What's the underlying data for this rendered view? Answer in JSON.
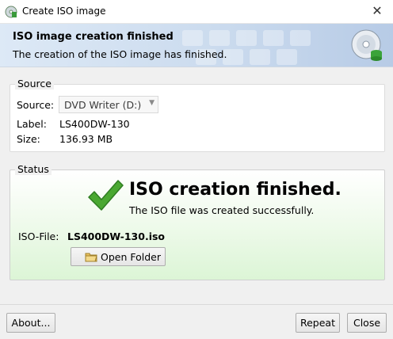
{
  "window": {
    "title": "Create ISO image",
    "close_glyph": "✕"
  },
  "banner": {
    "title": "ISO image creation finished",
    "subtitle": "The creation of the ISO image has finished."
  },
  "source": {
    "legend": "Source",
    "source_label": "Source:",
    "source_value": "DVD Writer (D:)",
    "label_label": "Label:",
    "label_value": "LS400DW-130",
    "size_label": "Size:",
    "size_value": "136.93 MB"
  },
  "status": {
    "legend": "Status",
    "headline": "ISO creation finished.",
    "message": "The ISO file was created successfully.",
    "iso_file_label": "ISO-File:",
    "iso_file_value": "LS400DW-130.iso",
    "open_folder_label": "Open Folder"
  },
  "buttons": {
    "about": "About...",
    "repeat": "Repeat",
    "close": "Close"
  },
  "colors": {
    "check_green": "#4aa832",
    "banner_blue": "#cbdbee",
    "status_green": "#dcf5d6"
  }
}
